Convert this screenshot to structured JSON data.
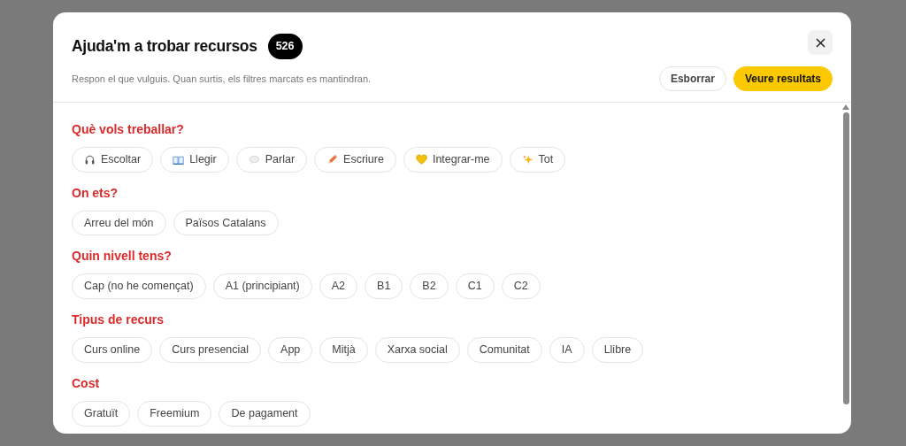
{
  "dialog": {
    "title": "Ajuda'm a trobar recursos",
    "count": "526",
    "subtitle": "Respon el que vulguis. Quan surtis, els filtres marcats es mantindran.",
    "buttons": [
      {
        "label": "Esborrar",
        "kind": "secondary"
      },
      {
        "label": "Veure resultats",
        "kind": "primary"
      }
    ]
  },
  "groups": [
    {
      "title": "Què vols treballar?",
      "kind": "icon-chips",
      "options": [
        {
          "label": "Escoltar",
          "selected": false
        },
        {
          "label": "Llegir",
          "selected": false
        },
        {
          "label": "Parlar",
          "selected": false
        },
        {
          "label": "Escriure",
          "selected": false
        },
        {
          "label": "Integrar-me",
          "selected": false
        },
        {
          "label": "Tot",
          "selected": false
        }
      ]
    },
    {
      "title": "On ets?",
      "kind": "chips",
      "options": [
        {
          "label": "Arreu del món",
          "selected": false
        },
        {
          "label": "Països Catalans",
          "selected": false
        }
      ]
    },
    {
      "title": "Quin nivell tens?",
      "kind": "chips",
      "options": [
        {
          "label": "Cap (no he començat)",
          "selected": false
        },
        {
          "label": "A1 (principiant)",
          "selected": false
        },
        {
          "label": "A2",
          "selected": false
        },
        {
          "label": "B1",
          "selected": false
        },
        {
          "label": "B2",
          "selected": false
        },
        {
          "label": "C1",
          "selected": false
        },
        {
          "label": "C2",
          "selected": false
        }
      ]
    },
    {
      "title": "Tipus de recurs",
      "kind": "chips",
      "options": [
        {
          "label": "Curs online",
          "selected": false
        },
        {
          "label": "Curs presencial",
          "selected": false
        },
        {
          "label": "App",
          "selected": false
        },
        {
          "label": "Mitjà",
          "selected": false
        },
        {
          "label": "Xarxa social",
          "selected": false
        },
        {
          "label": "Comunitat",
          "selected": false
        },
        {
          "label": "IA",
          "selected": false
        },
        {
          "label": "Llibre",
          "selected": false
        }
      ]
    },
    {
      "title": "Cost",
      "kind": "chips",
      "options": [
        {
          "label": "Gratuït",
          "selected": false
        },
        {
          "label": "Freemium",
          "selected": false
        },
        {
          "label": "De pagament",
          "selected": false
        }
      ]
    }
  ]
}
